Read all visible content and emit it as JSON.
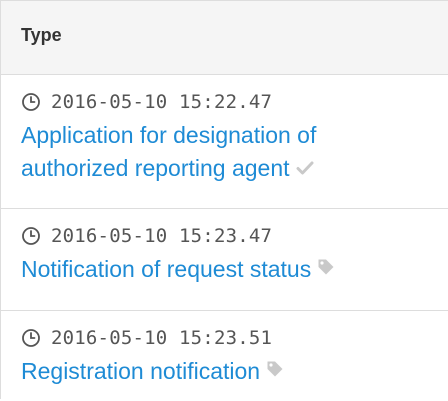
{
  "table": {
    "header": {
      "type_label": "Type"
    },
    "rows": [
      {
        "timestamp": "2016-05-10 15:22.47",
        "title": "Application for designation of authorized reporting agent",
        "status_icon": "check-icon"
      },
      {
        "timestamp": "2016-05-10 15:23.47",
        "title": "Notification of request status",
        "status_icon": "tag-icon"
      },
      {
        "timestamp": "2016-05-10 15:23.51",
        "title": "Registration notification",
        "status_icon": "tag-icon"
      }
    ]
  },
  "colors": {
    "link": "#1e8bd5",
    "muted_icon": "#c9c9c9",
    "header_bg": "#f5f5f5",
    "border": "#dddddd"
  }
}
